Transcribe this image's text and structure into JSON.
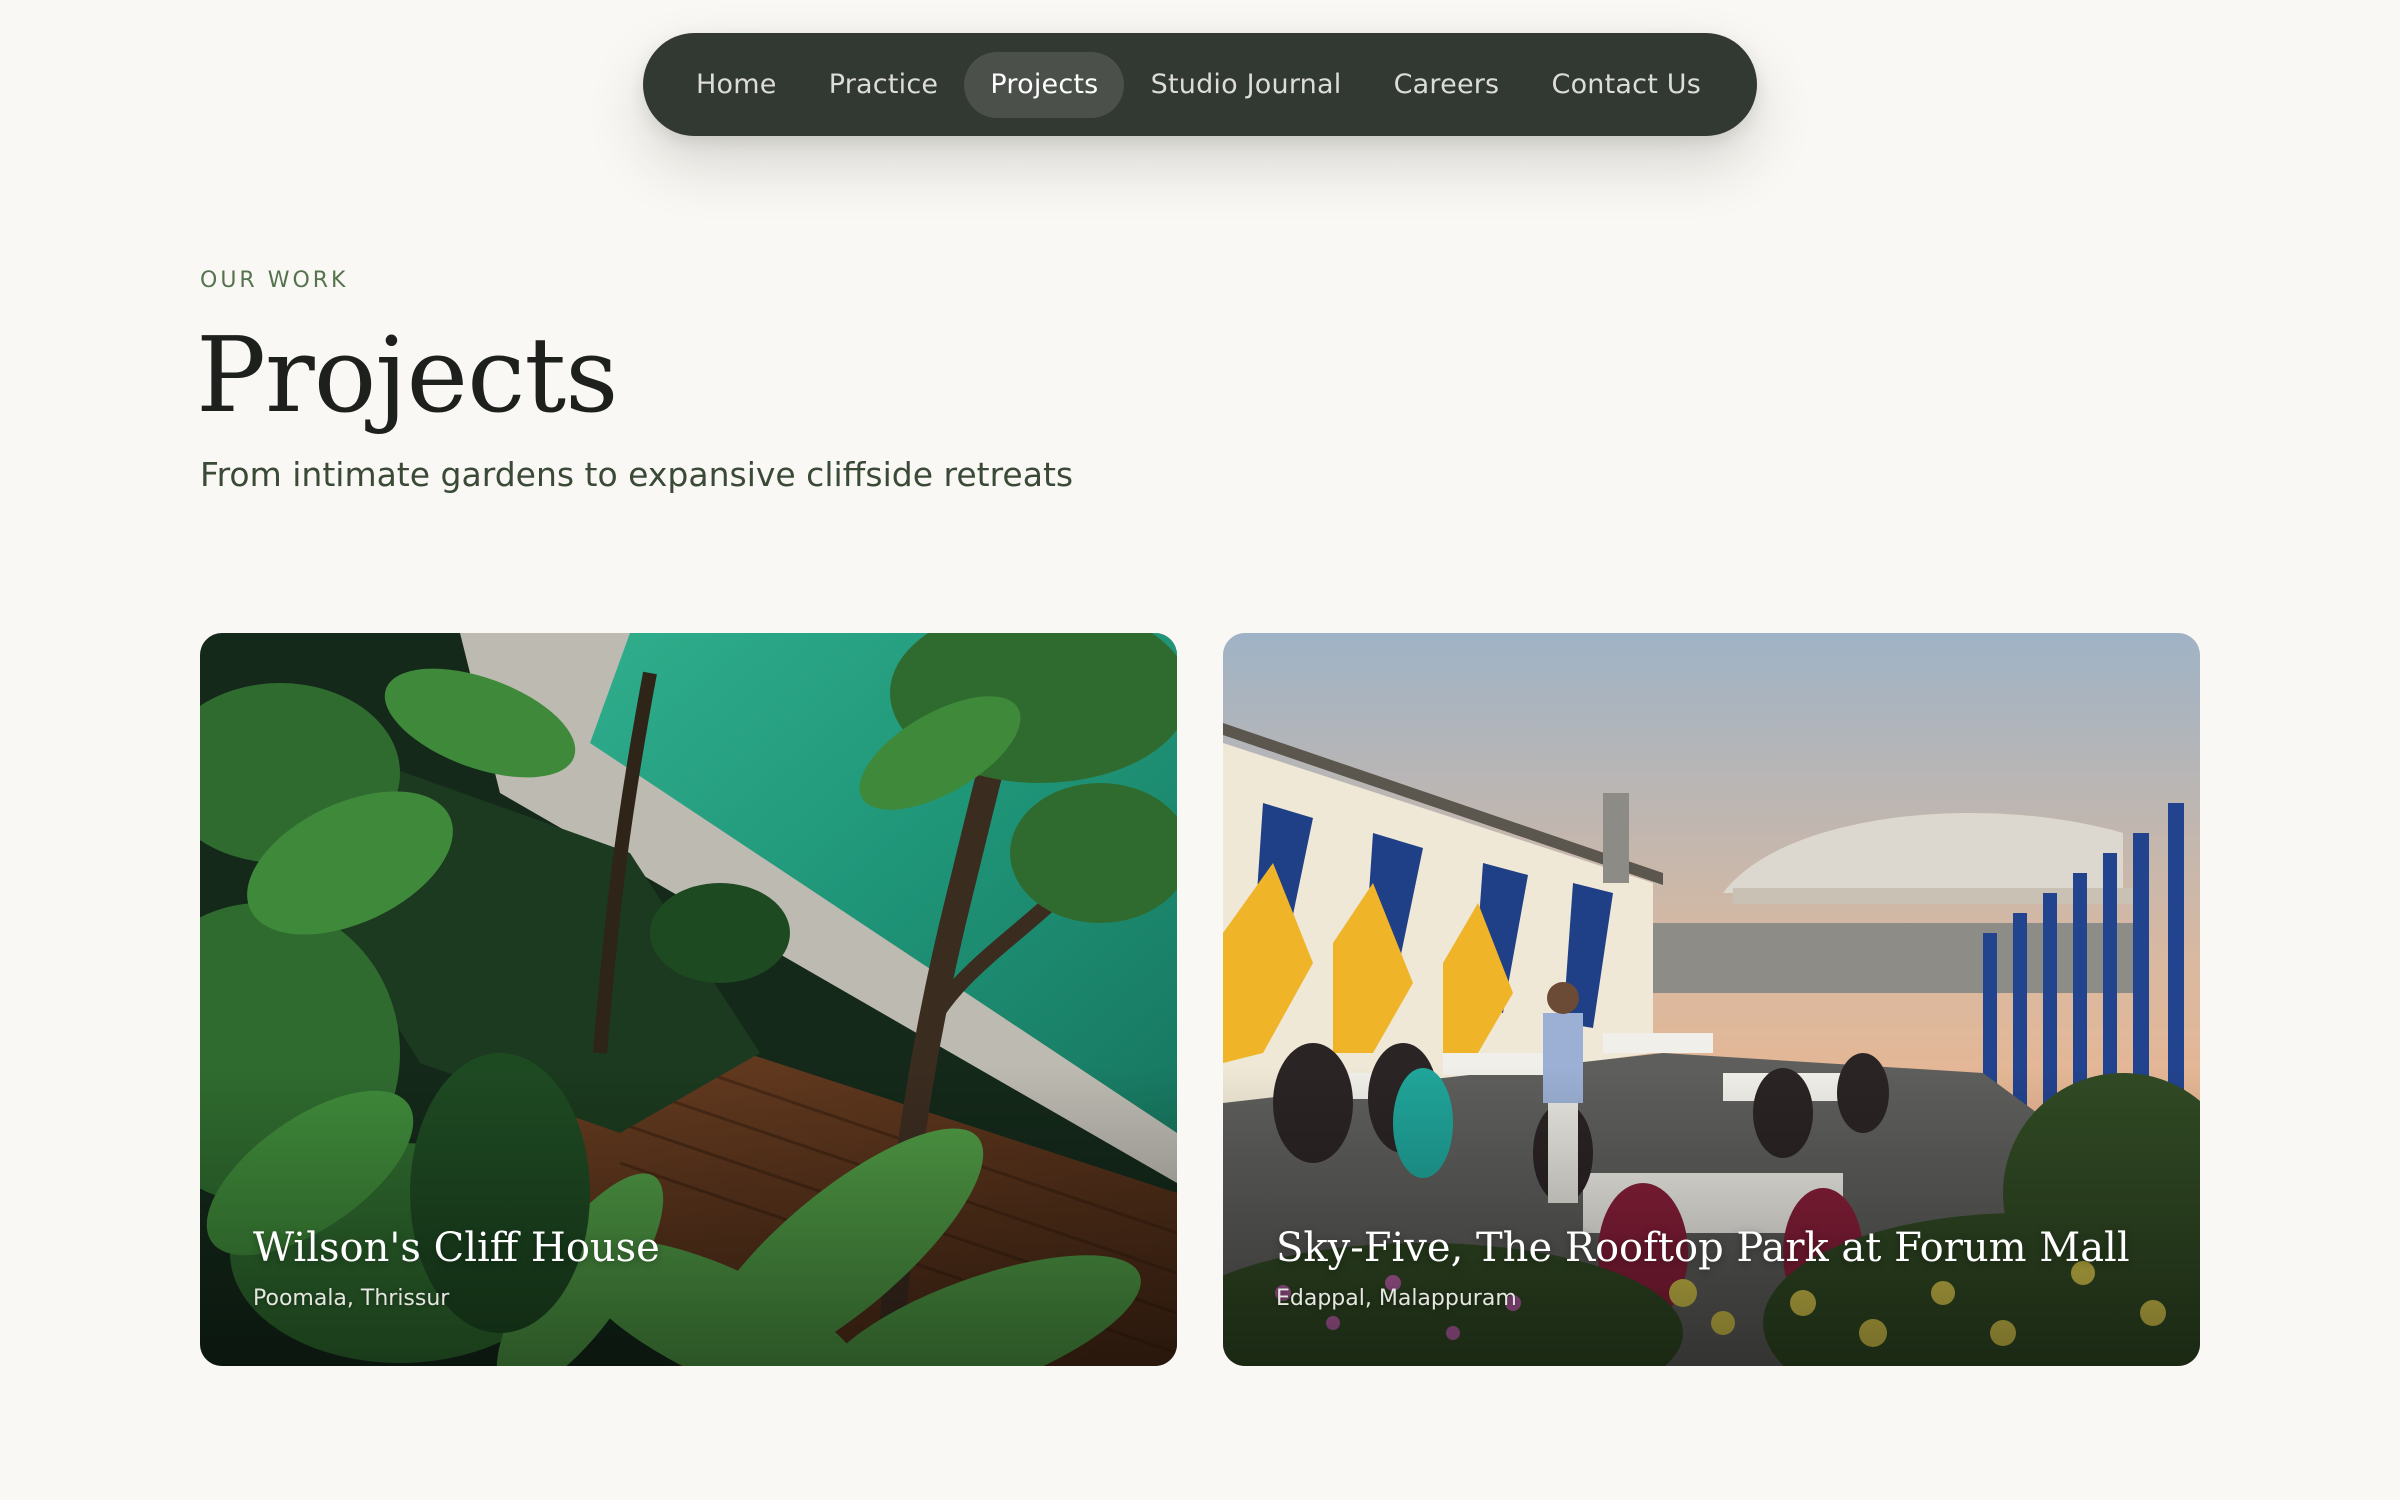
{
  "nav": {
    "items": [
      {
        "label": "Home"
      },
      {
        "label": "Practice"
      },
      {
        "label": "Projects",
        "active": true
      },
      {
        "label": "Studio Journal"
      },
      {
        "label": "Careers"
      },
      {
        "label": "Contact Us"
      }
    ]
  },
  "header": {
    "eyebrow": "OUR WORK",
    "title": "Projects",
    "subtitle": "From intimate gardens to expansive cliffside retreats"
  },
  "projects": [
    {
      "title": "Wilson's Cliff House",
      "location": "Poomala, Thrissur"
    },
    {
      "title": "Sky-Five, The Rooftop Park at Forum Mall",
      "location": "Edappal, Malappuram"
    }
  ],
  "colors": {
    "background": "#f9f8f4",
    "nav_bg": "#323832",
    "nav_active": "#4b514a",
    "eyebrow": "#55734f"
  }
}
